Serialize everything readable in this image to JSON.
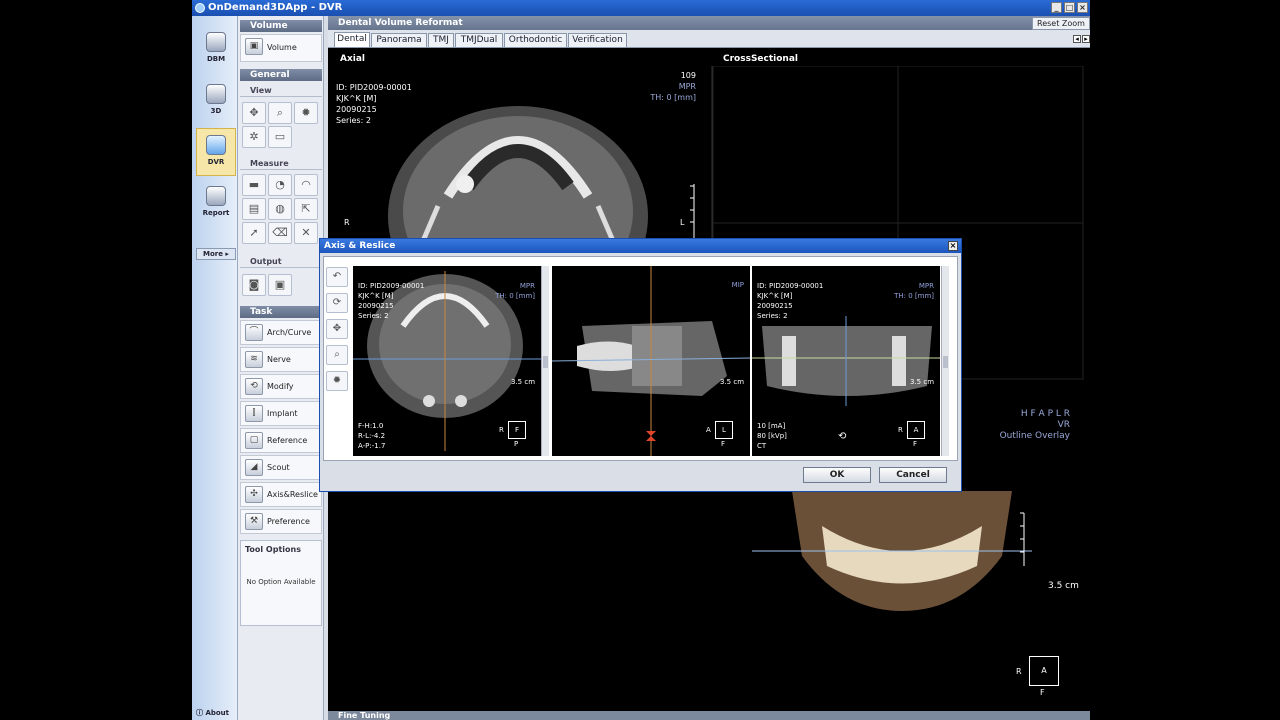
{
  "window": {
    "title": "OnDemand3DApp - DVR",
    "controls": [
      "_",
      "□",
      "×"
    ]
  },
  "rail": {
    "items": [
      {
        "label": "DBM",
        "icon": "database-icon",
        "active": false
      },
      {
        "label": "3D",
        "icon": "3d-camera-icon",
        "active": false
      },
      {
        "label": "DVR",
        "icon": "tooth-icon",
        "active": true
      },
      {
        "label": "Report",
        "icon": "report-icon",
        "active": false
      }
    ],
    "more": "More",
    "about": "About"
  },
  "panel": {
    "volume": "Volume",
    "volume_btn": "Volume",
    "general": "General",
    "view": "View",
    "measure": "Measure",
    "output": "Output",
    "task": "Task",
    "tasks": [
      "Arch/Curve",
      "Nerve",
      "Modify",
      "Implant",
      "Reference",
      "Scout",
      "Axis&Reslice",
      "Preference"
    ],
    "tool_options_title": "Tool Options",
    "tool_options_value": "No Option Available"
  },
  "main": {
    "header": "Dental Volume Reformat",
    "reset_zoom": "Reset Zoom",
    "tabs": [
      "Dental",
      "Panorama",
      "TMJ",
      "TMJDual",
      "Orthodontic",
      "Verification"
    ],
    "active_tab": "Dental",
    "axial_label": "Axial",
    "cross_label": "CrossSectional",
    "axial_info": [
      "ID: PID2009-00001",
      "KJK^K [M]",
      "20090215",
      "Series: 2"
    ],
    "axial_right": {
      "slice": "109",
      "mode": "MPR",
      "th": "TH: 0 [mm]"
    },
    "axial_R": "R",
    "axial_L": "L",
    "vr_orient": "H F A P L R",
    "vr_mode": "VR",
    "vr_overlay": "Outline Overlay",
    "vr_scale": "3.5 cm",
    "vr_box": "A",
    "vr_R": "R",
    "vr_F": "F",
    "fine_tuning": "Fine Tuning"
  },
  "dialog": {
    "title": "Axis & Reslice",
    "close": "×",
    "view1": {
      "info": [
        "ID: PID2009-00001",
        "KJK^K [M]",
        "20090215",
        "Series: 2"
      ],
      "mode": "MPR",
      "th": "TH: 0 [mm]",
      "scale": "3.5 cm",
      "bottom": [
        "F-H:1.0",
        "R-L:-4.2",
        "A-P:-1.7"
      ],
      "box": "F",
      "R": "R",
      "P": "P"
    },
    "view2": {
      "mode": "MIP",
      "scale": "3.5 cm",
      "box": "L",
      "A": "A",
      "F": "F"
    },
    "view3": {
      "info": [
        "ID: PID2009-00001",
        "KJK^K [M]",
        "20090215",
        "Series: 2"
      ],
      "mode": "MPR",
      "th": "TH: 0 [mm]",
      "scale": "3.5 cm",
      "bottom": [
        "10 [mA]",
        "80 [kVp]",
        "CT"
      ],
      "box": "A",
      "R": "R",
      "F": "F"
    },
    "ok": "OK",
    "cancel": "Cancel"
  }
}
